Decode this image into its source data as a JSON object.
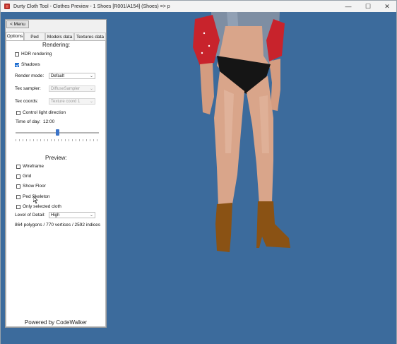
{
  "window": {
    "title": "Durty Cloth Tool - Clothes Preview - 1 Shoes [R001/A154] (Shoes) => p",
    "controls": {
      "minimize": "—",
      "maximize": "☐",
      "close": "✕"
    }
  },
  "menu_button": "< Menu",
  "tabs": [
    {
      "label": "Options",
      "active": true
    },
    {
      "label": "Ped",
      "active": false
    },
    {
      "label": "Models data",
      "active": false
    },
    {
      "label": "Textures data",
      "active": false
    }
  ],
  "rendering": {
    "title": "Rendering:",
    "hdr": {
      "label": "HDR rendering",
      "checked": false
    },
    "shadows": {
      "label": "Shadows",
      "checked": true
    },
    "render_mode": {
      "label": "Render mode:",
      "value": "Default"
    },
    "tex_sampler": {
      "label": "Tex sampler:",
      "value": "DiffuseSampler"
    },
    "tex_coords": {
      "label": "Tex coords:",
      "value": "Texture coord 1"
    },
    "light_dir": {
      "label": "Control light direction",
      "checked": false
    },
    "time_of_day": {
      "label": "Time of day:",
      "value": "12:00",
      "slider_fraction": 0.5
    }
  },
  "preview": {
    "title": "Preview:",
    "wireframe": {
      "label": "Wireframe",
      "checked": false
    },
    "grid": {
      "label": "Grid",
      "checked": false
    },
    "show_floor": {
      "label": "Show Floor",
      "checked": false
    },
    "ped_skeleton": {
      "label": "Ped Skeleton",
      "checked": false
    },
    "only_selected": {
      "label": "Only selected cloth",
      "checked": false
    },
    "lod": {
      "label": "Level of Detail:",
      "value": "High"
    },
    "stats": "864 polygons / 770 vertices / 2592 indices"
  },
  "footer": "Powered by CodeWalker",
  "colors": {
    "viewport_bg": "#3c6b9c",
    "accent": "#1f6fd1",
    "skin": "#d9a58a",
    "boots": "#8a5214",
    "jacket_denim": "#7e8ea3",
    "shirt_red": "#c8232c",
    "briefs": "#151515"
  }
}
